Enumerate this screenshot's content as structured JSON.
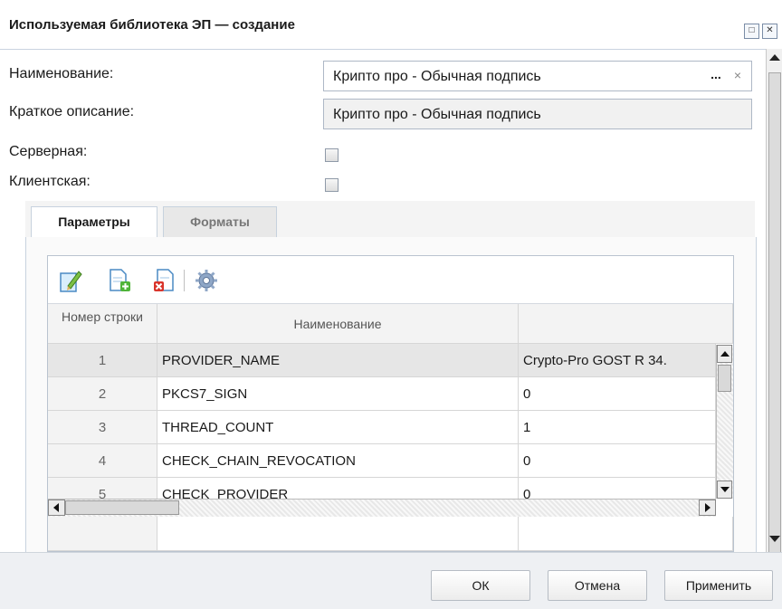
{
  "window": {
    "title": "Используемая библиотека ЭП — создание",
    "maximize_icon": "maximize-icon",
    "close_icon": "close-icon"
  },
  "form": {
    "name_label": "Наименование:",
    "name_value": "Крипто про - Обычная подпись",
    "name_dots": "...",
    "name_clear": "×",
    "short_label": "Краткое описание:",
    "short_value": "Крипто про - Обычная подпись",
    "server_label": "Серверная:",
    "server_checked": false,
    "client_label": "Клиентская:",
    "client_checked": false
  },
  "tabs": [
    {
      "label": "Параметры",
      "active": true
    },
    {
      "label": "Форматы",
      "active": false
    }
  ],
  "grid": {
    "toolbar": [
      "edit-icon",
      "add-icon",
      "delete-icon",
      "settings-icon"
    ],
    "columns": [
      "Номер строки",
      "Наименование",
      ""
    ],
    "rows": [
      {
        "num": "1",
        "name": "PROVIDER_NAME",
        "value": "Crypto-Pro GOST R 34."
      },
      {
        "num": "2",
        "name": "PKCS7_SIGN",
        "value": "0"
      },
      {
        "num": "3",
        "name": "THREAD_COUNT",
        "value": "1"
      },
      {
        "num": "4",
        "name": "CHECK_CHAIN_REVOCATION",
        "value": "0"
      },
      {
        "num": "5",
        "name": "CHECK_PROVIDER",
        "value": "0"
      }
    ]
  },
  "buttons": {
    "ok": "ОК",
    "cancel": "Отмена",
    "apply": "Применить"
  },
  "colors": {
    "border": "#c7d2de",
    "selected_row": "#e6e6e6"
  }
}
